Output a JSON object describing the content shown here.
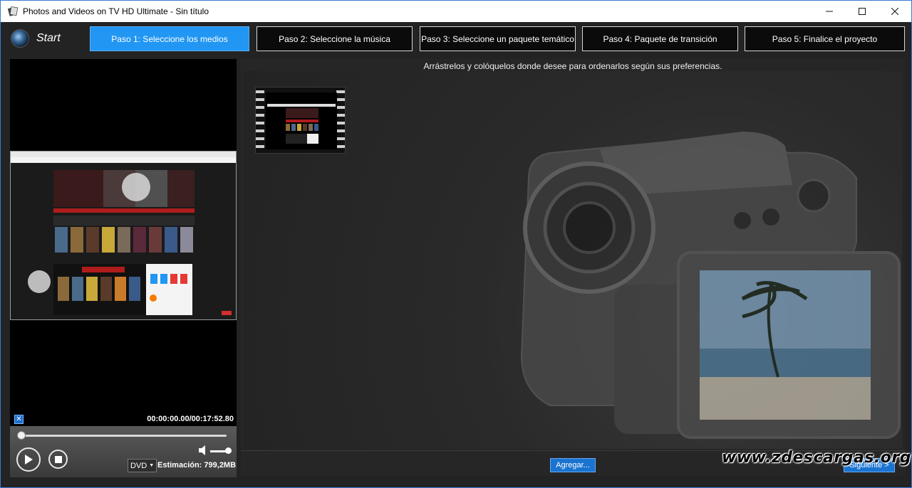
{
  "window": {
    "title": "Photos and Videos on TV HD Ultimate - Sin título",
    "controls": [
      "minimize",
      "maximize",
      "close"
    ]
  },
  "start": {
    "label": "Start"
  },
  "steps": [
    {
      "label": "Paso 1: Seleccione los medios",
      "active": true
    },
    {
      "label": "Paso 2: Seleccione la música",
      "active": false
    },
    {
      "label": "Paso 3: Seleccione un paquete temático",
      "active": false
    },
    {
      "label": "Paso 4: Paquete de transición",
      "active": false
    },
    {
      "label": "Paso 5: Finalice el proyecto",
      "active": false
    }
  ],
  "preview": {
    "timecode": "00:00:00.00/00:17:52.80",
    "seek_fraction": 0.0
  },
  "player": {
    "format": "DVD",
    "estimate": "Estimación: 799,2MB"
  },
  "media": {
    "hint": "Arrástrelos y colóquelos donde desee para ordenarlos según sus preferencias.",
    "add_label": "Agregar...",
    "next_label": "Siguiente >"
  },
  "watermark": "www.zdescargas.org",
  "colors": {
    "accent": "#2196f3",
    "button_blue": "#1a73d0",
    "background": "#232323"
  }
}
